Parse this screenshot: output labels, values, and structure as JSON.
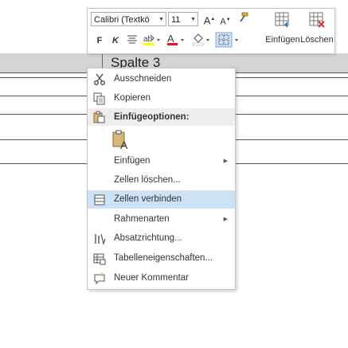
{
  "document": {
    "column_header": "Spalte 3"
  },
  "mini_toolbar": {
    "font_name": "Calibri (Textkö",
    "font_size": "11",
    "grow_font_icon": "A",
    "shrink_font_icon": "A",
    "bold_label": "F",
    "italic_label": "K",
    "font_color_icon": "A",
    "insert_label": "Einfügen",
    "delete_label": "Löschen"
  },
  "context_menu": {
    "items": [
      {
        "label": "Ausschneiden",
        "icon": "scissors-icon"
      },
      {
        "label": "Kopieren",
        "icon": "copy-icon"
      },
      {
        "label": "Einfügeoptionen:",
        "icon": "paste-icon"
      },
      {
        "label": "",
        "icon": "paste-keep-text-icon"
      },
      {
        "label": "Einfügen",
        "icon": "",
        "submenu": true
      },
      {
        "label": "Zellen löschen...",
        "icon": ""
      },
      {
        "label": "Zellen verbinden",
        "icon": "merge-cells-icon",
        "highlighted": true
      },
      {
        "label": "Rahmenarten",
        "icon": "",
        "submenu": true
      },
      {
        "label": "Absatzrichtung...",
        "icon": "text-direction-icon"
      },
      {
        "label": "Tabelleneigenschaften...",
        "icon": "table-properties-icon"
      },
      {
        "label": "Neuer Kommentar",
        "icon": "new-comment-icon"
      }
    ]
  },
  "colors": {
    "highlight": "#cde1f7",
    "font_color_underline": "#e81123",
    "highlight_color_underline": "#ffff00",
    "delete_red": "#d13438"
  }
}
